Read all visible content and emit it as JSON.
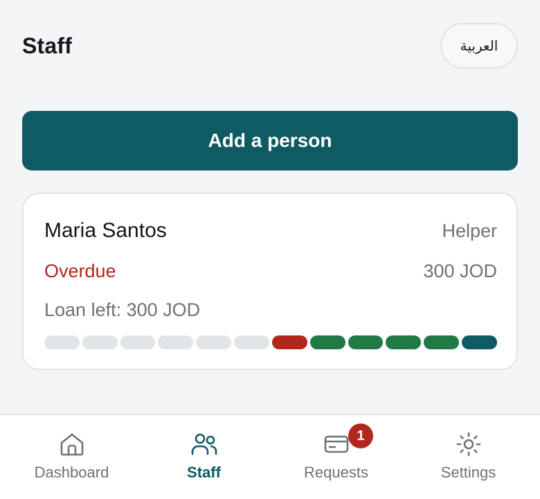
{
  "header": {
    "title": "Staff",
    "language_toggle": "العربية"
  },
  "actions": {
    "add_person": "Add a person"
  },
  "staff_card": {
    "name": "Maria Santos",
    "role": "Helper",
    "status": "Overdue",
    "amount": "300 JOD",
    "loan_left": "Loan left: 300 JOD",
    "progress_segments": [
      "empty",
      "empty",
      "empty",
      "empty",
      "empty",
      "empty",
      "overdue",
      "paid",
      "paid",
      "paid",
      "paid",
      "current"
    ]
  },
  "tabs": [
    {
      "label": "Dashboard",
      "icon": "home-icon",
      "active": false
    },
    {
      "label": "Staff",
      "icon": "people-icon",
      "active": true
    },
    {
      "label": "Requests",
      "icon": "card-icon",
      "active": false,
      "badge": "1"
    },
    {
      "label": "Settings",
      "icon": "gear-icon",
      "active": false
    }
  ],
  "colors": {
    "accent": "#0f5b63",
    "danger": "#b3261e",
    "success": "#1f7a45",
    "muted": "#6b7278"
  }
}
